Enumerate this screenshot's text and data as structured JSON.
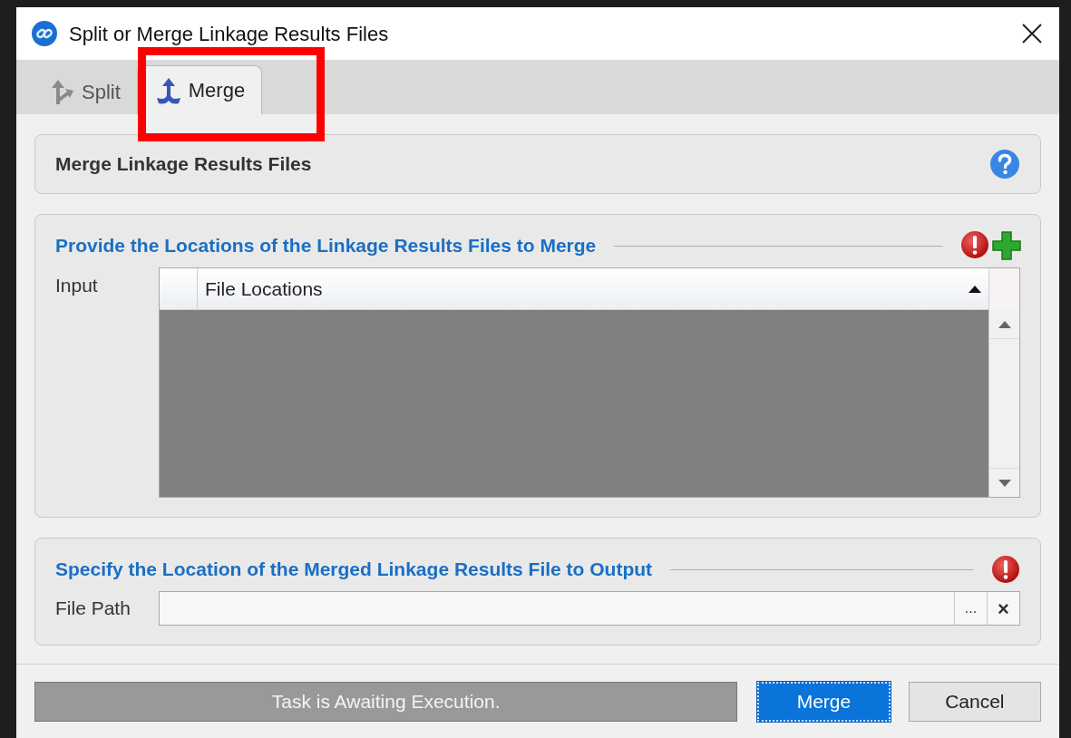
{
  "window": {
    "title": "Split or Merge Linkage Results Files"
  },
  "tabs": [
    {
      "label": "Split",
      "selected": false,
      "kind": "split"
    },
    {
      "label": "Merge",
      "selected": true,
      "kind": "merge"
    }
  ],
  "highlight": {
    "on": true
  },
  "header": {
    "title": "Merge Linkage Results Files"
  },
  "input_section": {
    "title": "Provide the Locations of the Linkage Results Files to Merge",
    "label": "Input",
    "table": {
      "columns": [
        "File Locations"
      ]
    }
  },
  "output_section": {
    "title": "Specify the Location of the Merged Linkage Results File to Output",
    "label": "File Path",
    "browse": "...",
    "clear": "×"
  },
  "status": "Task is Awaiting Execution.",
  "buttons": [
    {
      "label": "Merge",
      "kind": "primary"
    },
    {
      "label": "Cancel",
      "kind": "secondary"
    }
  ]
}
